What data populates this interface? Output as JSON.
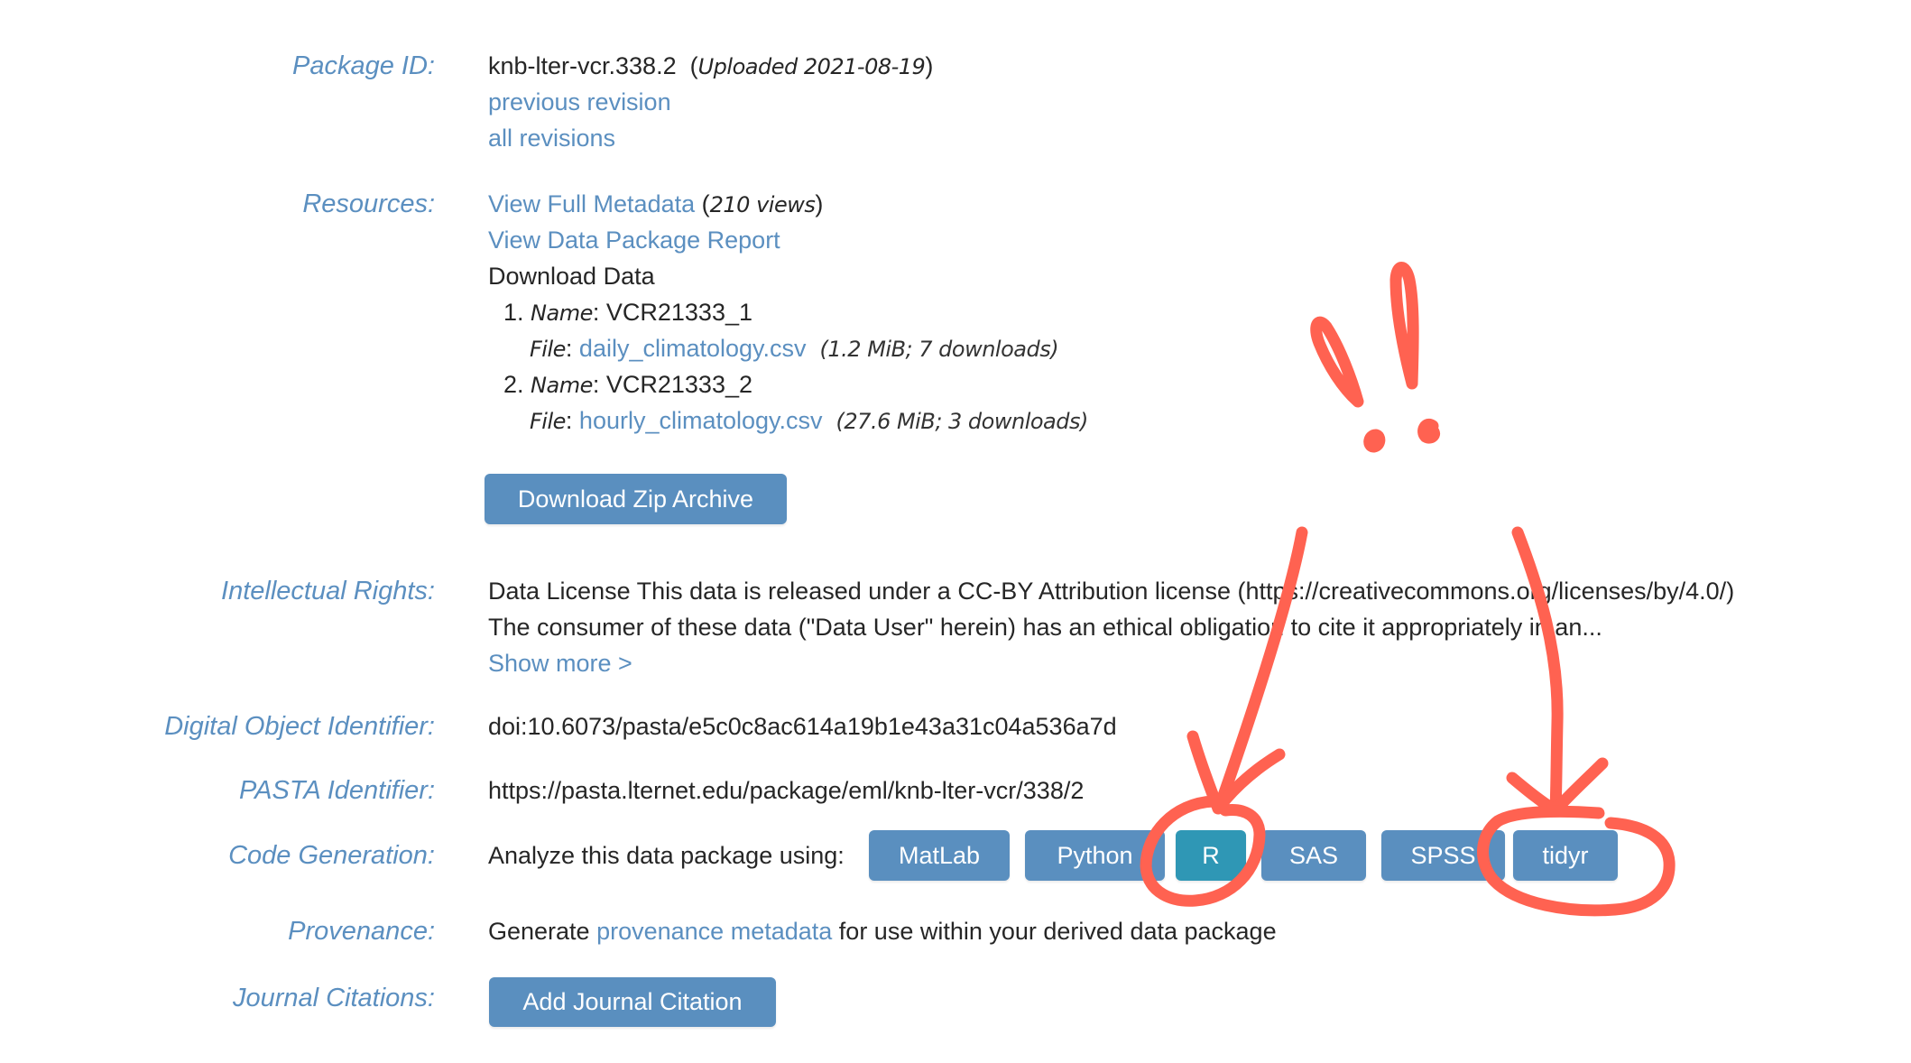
{
  "package_id": {
    "label": "Package ID:",
    "id": "knb-lter-vcr.338.2",
    "uploaded_prefix": "(",
    "uploaded_text": "Uploaded 2021-08-19",
    "uploaded_suffix": ")",
    "previous_revision": "previous revision",
    "all_revisions": "all revisions"
  },
  "resources": {
    "label": "Resources:",
    "view_full_metadata": "View Full Metadata",
    "views_open": "(",
    "views": "210 views",
    "views_close": ")",
    "view_report": "View Data Package Report",
    "download_data": "Download Data",
    "files": [
      {
        "number": "1.",
        "name_label": "Name",
        "name": "VCR21333_1",
        "file_label": "File",
        "file": "daily_climatology.csv",
        "info": "(1.2 MiB; 7 downloads)"
      },
      {
        "number": "2.",
        "name_label": "Name",
        "name": "VCR21333_2",
        "file_label": "File",
        "file": "hourly_climatology.csv",
        "info": "(27.6 MiB; 3 downloads)"
      }
    ],
    "download_zip": "Download Zip Archive"
  },
  "intellectual_rights": {
    "label": "Intellectual Rights:",
    "line1": "Data License This data is released under a CC-BY Attribution license (https://creativecommons.org/licenses/by/4.0/)",
    "line2": "The consumer of these data (\"Data User\" herein) has an ethical obligation to cite it appropriately in an...",
    "show_more": "Show more >"
  },
  "doi": {
    "label": "Digital Object Identifier:",
    "value": "doi:10.6073/pasta/e5c0c8ac614a19b1e43a31c04a536a7d"
  },
  "pasta": {
    "label": "PASTA Identifier:",
    "value": "https://pasta.lternet.edu/package/eml/knb-lter-vcr/338/2"
  },
  "code_generation": {
    "label": "Code Generation:",
    "prompt": "Analyze this data package using:",
    "buttons": [
      {
        "label": "MatLab",
        "active": false
      },
      {
        "label": "Python",
        "active": false
      },
      {
        "label": "R",
        "active": true
      },
      {
        "label": "SAS",
        "active": false
      },
      {
        "label": "SPSS",
        "active": false
      },
      {
        "label": "tidyr",
        "active": false
      }
    ]
  },
  "provenance": {
    "label": "Provenance:",
    "prefix": "Generate",
    "link": "provenance metadata",
    "suffix": "for use within your derived data package"
  },
  "journal_citations": {
    "label": "Journal Citations:",
    "button": "Add Journal Citation"
  },
  "colors": {
    "label": "#5b8fc0",
    "link": "#5b8fc0",
    "button": "#5a8fbf",
    "button_active": "#2f97b5",
    "annotation": "#ff6251"
  },
  "annotations": {
    "marks": [
      "exclamation-marks",
      "arrow-to-R",
      "arrow-to-tidyr",
      "circle-R",
      "circle-tidyr"
    ]
  }
}
